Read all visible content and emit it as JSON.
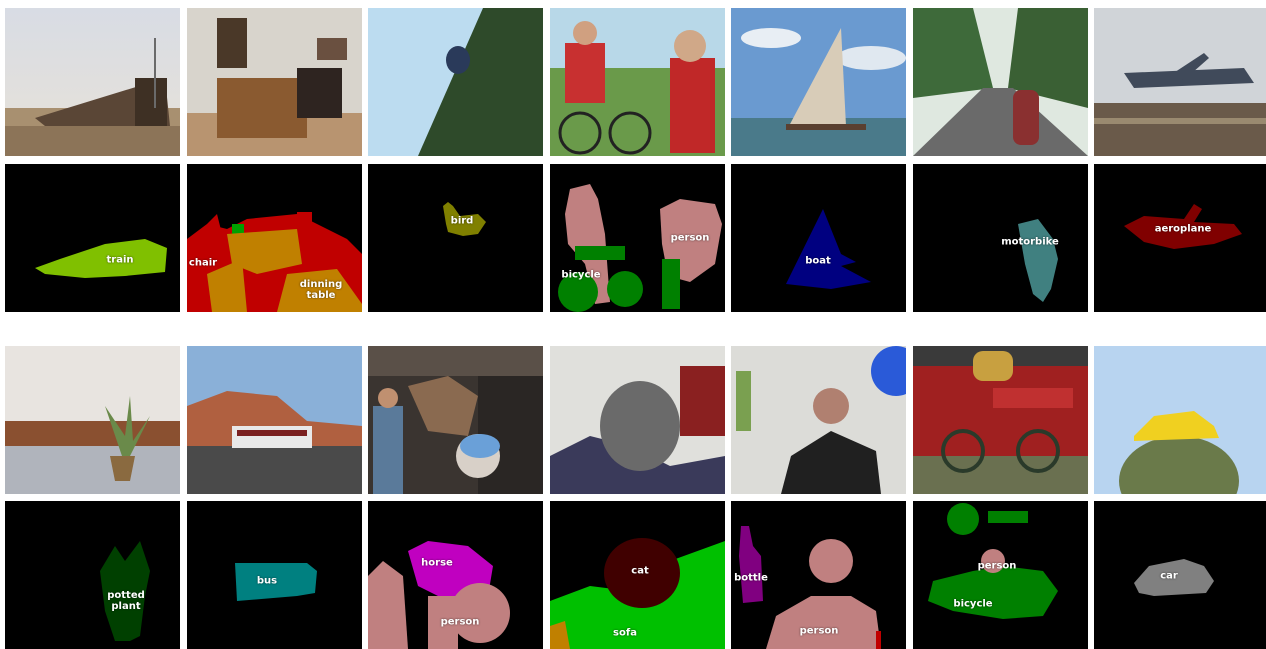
{
  "palette": {
    "train": "#80c000",
    "chair": "#c00000",
    "dinning_table": "#c08000",
    "bird": "#808000",
    "person": "#c08080",
    "bicycle": "#008000",
    "boat": "#000080",
    "motorbike": "#408080",
    "aeroplane": "#800000",
    "potted_plant": "#004000",
    "bus": "#008080",
    "horse": "#c000c0",
    "cat": "#400000",
    "sofa": "#00c000",
    "bottle": "#800080",
    "car": "#808080",
    "background": "#000000"
  },
  "labels": {
    "train": "train",
    "chair": "chair",
    "dinning_table": "dinning\ntable",
    "bird": "bird",
    "person": "person",
    "bicycle": "bicycle",
    "boat": "boat",
    "motorbike": "motorbike",
    "aeroplane": "aeroplane",
    "potted_plant": "potted\nplant",
    "bus": "bus",
    "horse": "horse",
    "cat": "cat",
    "sofa": "sofa",
    "bottle": "bottle",
    "car": "car"
  },
  "tiles": [
    {
      "photo": "train-photo",
      "mask": "train-mask",
      "classes": [
        "train"
      ]
    },
    {
      "photo": "dining-room-photo",
      "mask": "dining-room-mask",
      "classes": [
        "chair",
        "dinning_table"
      ]
    },
    {
      "photo": "bird-photo",
      "mask": "bird-mask",
      "classes": [
        "bird"
      ]
    },
    {
      "photo": "cyclists-photo",
      "mask": "cyclists-mask",
      "classes": [
        "bicycle",
        "person"
      ]
    },
    {
      "photo": "boat-photo",
      "mask": "boat-mask",
      "classes": [
        "boat"
      ]
    },
    {
      "photo": "motorbike-photo",
      "mask": "motorbike-mask",
      "classes": [
        "motorbike"
      ]
    },
    {
      "photo": "aeroplane-photo",
      "mask": "aeroplane-mask",
      "classes": [
        "aeroplane"
      ]
    },
    {
      "photo": "potted-plant-photo",
      "mask": "potted-plant-mask",
      "classes": [
        "potted_plant"
      ]
    },
    {
      "photo": "bus-photo",
      "mask": "bus-mask",
      "classes": [
        "bus"
      ]
    },
    {
      "photo": "horse-photo",
      "mask": "horse-mask",
      "classes": [
        "horse",
        "person"
      ]
    },
    {
      "photo": "cat-photo",
      "mask": "cat-mask",
      "classes": [
        "cat",
        "sofa"
      ]
    },
    {
      "photo": "man-bottle-photo",
      "mask": "man-bottle-mask",
      "classes": [
        "bottle",
        "person"
      ]
    },
    {
      "photo": "bicycle-sign-photo",
      "mask": "bicycle-sign-mask",
      "classes": [
        "person",
        "bicycle"
      ]
    },
    {
      "photo": "car-photo",
      "mask": "car-mask",
      "classes": [
        "car"
      ]
    }
  ]
}
